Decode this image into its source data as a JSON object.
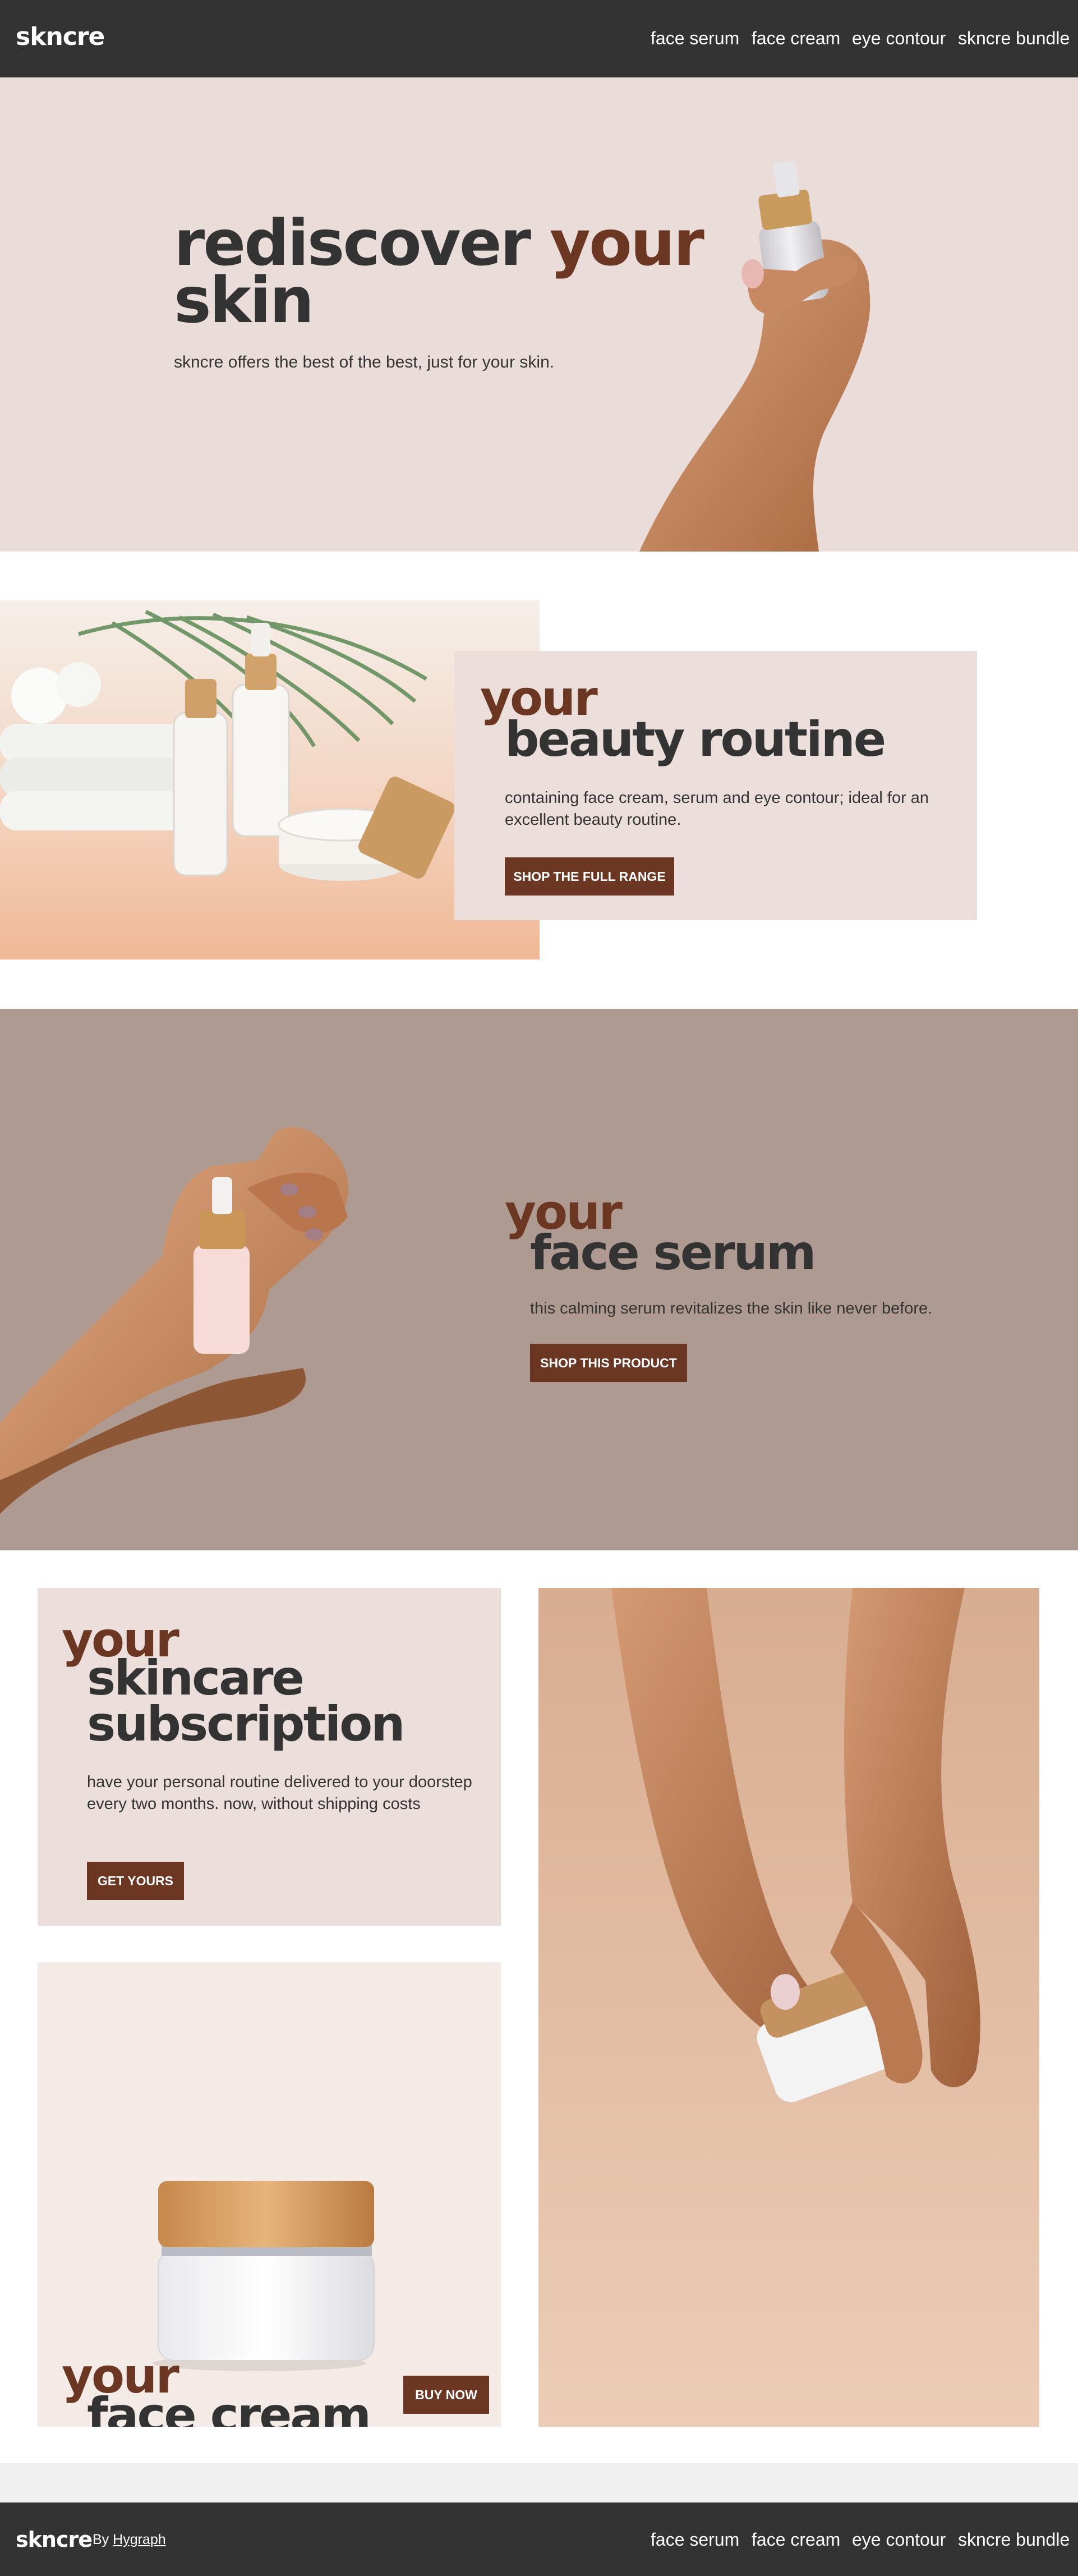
{
  "brand": "skncre",
  "nav": [
    "face serum",
    "face cream",
    "eye contour",
    "skncre bundle"
  ],
  "hero": {
    "title_a": "rediscover",
    "title_b": "your",
    "title_c": "skin",
    "subtitle": "skncre offers the best of the best, just for your skin."
  },
  "routine": {
    "kicker": "your",
    "title": "beauty routine",
    "text": "containing face cream, serum and eye contour; ideal for an excellent beauty routine.",
    "button": "SHOP THE FULL RANGE"
  },
  "serum": {
    "kicker": "your",
    "title": "face serum",
    "text": "this calming serum revitalizes the skin like never before.",
    "button": "SHOP THIS PRODUCT"
  },
  "subscription": {
    "kicker": "your",
    "title_line1": "skincare",
    "title_line2": "subscription",
    "text": "have your personal routine delivered to your doorstep every two months. now, without shipping costs",
    "button": "GET YOURS"
  },
  "cream": {
    "kicker": "your",
    "title": "face cream",
    "button": "BUY NOW"
  },
  "footer": {
    "brand": "skncre",
    "by_label": "By",
    "by_link": "Hygraph",
    "nav": [
      "face serum",
      "face cream",
      "eye contour",
      "skncre bundle"
    ]
  },
  "colors": {
    "header_bg": "#333333",
    "hero_bg": "#e9dcd9",
    "panel_bg": "#ecdfdb",
    "serum_bg": "#ae9a91",
    "accent": "#6b3723",
    "text": "#333333"
  }
}
